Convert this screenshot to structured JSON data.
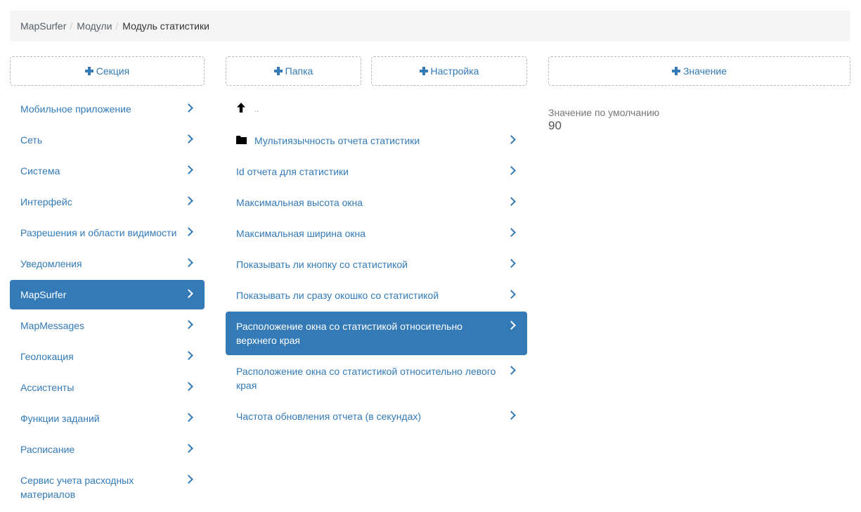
{
  "breadcrumb": {
    "items": [
      "MapSurfer",
      "Модули"
    ],
    "separator": "/",
    "current": "Модуль статистики"
  },
  "buttons": {
    "add_section": "Секция",
    "add_folder": "Папка",
    "add_setting": "Настройка",
    "add_value": "Значение"
  },
  "sections": {
    "active_index": 6,
    "items": [
      {
        "label": "Мобильное приложение"
      },
      {
        "label": "Сеть"
      },
      {
        "label": "Система"
      },
      {
        "label": "Интерфейс"
      },
      {
        "label": "Разрешения и области видимости"
      },
      {
        "label": "Уведомления"
      },
      {
        "label": "MapSurfer"
      },
      {
        "label": "MapMessages"
      },
      {
        "label": "Геолокация"
      },
      {
        "label": "Ассистенты"
      },
      {
        "label": "Функции заданий"
      },
      {
        "label": "Расписание"
      },
      {
        "label": "Сервис учета расходных материалов"
      }
    ]
  },
  "settings": {
    "up_label": "..",
    "folder": {
      "label": "Мультиязычность отчета статистики",
      "icon": "folder-icon"
    },
    "active_index": 5,
    "items": [
      {
        "label": "Id отчета для статистики"
      },
      {
        "label": "Максимальная высота окна"
      },
      {
        "label": "Максимальная ширина окна"
      },
      {
        "label": "Показывать ли кнопку со статистикой"
      },
      {
        "label": "Показывать ли сразу окошко со статистикой"
      },
      {
        "label": "Расположение окна со статистикой относительно верхнего края"
      },
      {
        "label": "Расположение окна со статистикой относительно левого края"
      },
      {
        "label": "Частота обновления отчета (в секундах)"
      }
    ]
  },
  "value": {
    "label": "Значение по умолчанию",
    "number": "90"
  },
  "colors": {
    "accent": "#337ab7",
    "breadcrumb_bg": "#f5f5f5"
  }
}
